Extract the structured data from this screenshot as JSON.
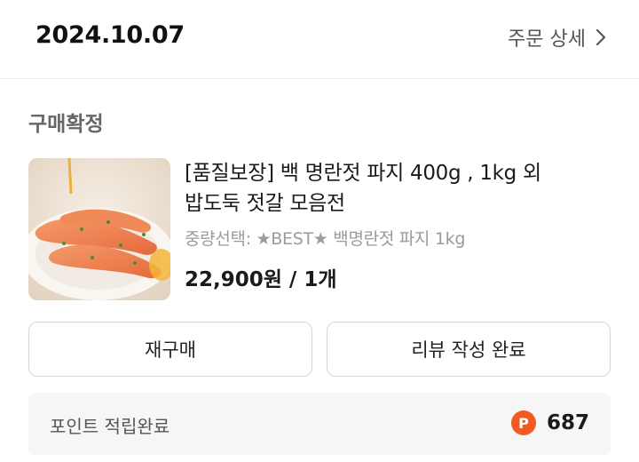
{
  "order": {
    "date": "2024.10.07",
    "detail_link_label": "주문 상세",
    "status": "구매확정"
  },
  "product": {
    "title_line1": "[품질보장] 백 명란젓 파지 400g , 1kg 외",
    "title_line2": "밥도둑 젓갈 모음전",
    "option": "중량선택: ★BEST★ 백명란젓 파지 1kg",
    "price": "22,900원 / 1개",
    "image_icon": "pollock-roe-photo"
  },
  "actions": {
    "rebuy_label": "재구매",
    "review_label": "리뷰 작성 완료"
  },
  "points": {
    "label": "포인트 적립완료",
    "icon_glyph": "P",
    "value": "687"
  },
  "colors": {
    "point_accent": "#f15a22",
    "status_gray": "#666666",
    "option_gray": "#9b9b9b"
  }
}
